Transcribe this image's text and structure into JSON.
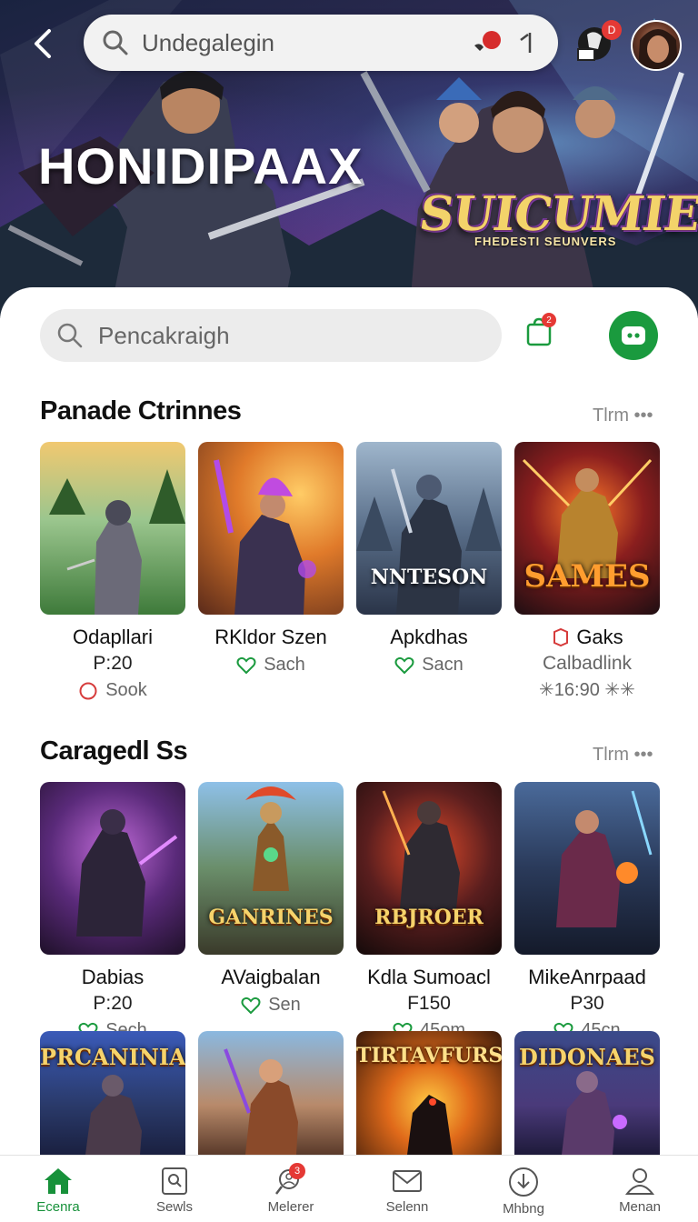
{
  "header": {
    "search_text": "Undegalegin",
    "notification_badge": "D",
    "hero_title": "HONIDIPAAX",
    "hero_logo": "SUICUMIES",
    "hero_logo_sub": "FHEDESTI SEUNVERS"
  },
  "toolbar": {
    "search_placeholder": "Pencakraigh",
    "bag_badge": "2"
  },
  "sections": [
    {
      "title": "Panade Ctrinnes",
      "more": "Tlrm •••",
      "cards": [
        {
          "name": "Odapllari",
          "line2": "P:20",
          "status": "Sook",
          "status_icon": "circle-outline-icon"
        },
        {
          "name": "RKldor Szen",
          "status": "Sach",
          "status_icon": "heart-icon",
          "thumb_label": ""
        },
        {
          "name": "Apkdhas",
          "status": "Sacn",
          "status_icon": "heart-icon",
          "thumb_label": "NNTESON"
        },
        {
          "name": "Gaks",
          "line2": "Calbadlink",
          "line3": "✳16:90 ✳✳",
          "thumb_label": "SAMES"
        }
      ]
    },
    {
      "title": "Caragedl Ss",
      "more": "Tlrm •••",
      "cards": [
        {
          "name": "Dabias",
          "line2": "P:20",
          "status": "Sech",
          "status_icon": "heart-icon"
        },
        {
          "name": "AVaigbalan",
          "status": "Sen",
          "status_icon": "heart-icon",
          "thumb_label": "GANRINES"
        },
        {
          "name": "Kdla Sumoacl",
          "line2": "F150",
          "status": "45om",
          "status_icon": "heart-icon",
          "thumb_label": "RBJROER"
        },
        {
          "name": "MikeAnrpaad",
          "line2": "P30",
          "status": "45cn",
          "status_icon": "heart-icon"
        }
      ]
    },
    {
      "cards": [
        {
          "thumb_label": "PRCANINIAS"
        },
        {
          "thumb_label": ""
        },
        {
          "thumb_label": "TIRTAVFURS"
        },
        {
          "thumb_label": "DIDONAES"
        }
      ]
    }
  ],
  "bottom_nav": [
    {
      "label": "Ecenra",
      "icon": "home-icon",
      "active": true
    },
    {
      "label": "Sewls",
      "icon": "search-icon"
    },
    {
      "label": "Melerer",
      "icon": "people-search-icon",
      "badge": "3"
    },
    {
      "label": "Selenn",
      "icon": "mail-icon"
    },
    {
      "label": "Mhbng",
      "icon": "download-icon"
    },
    {
      "label": "Menan",
      "icon": "profile-icon"
    }
  ],
  "colors": {
    "accent_green": "#1a9a3e",
    "badge_red": "#e53935"
  }
}
